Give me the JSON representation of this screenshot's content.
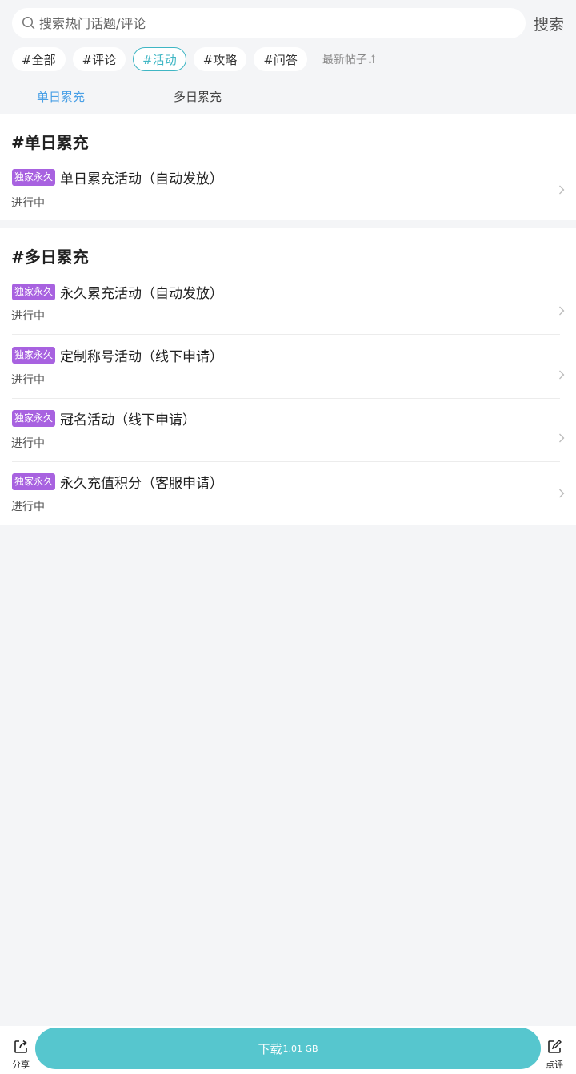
{
  "search": {
    "placeholder": "搜索热门话题/评论",
    "button_label": "搜索"
  },
  "chips": [
    "#全部",
    "#评论",
    "#活动",
    "#攻略",
    "#问答"
  ],
  "active_chip": "#活动",
  "sort_label": "最新帖子",
  "sort_icon": "sort-arrows-icon",
  "subtabs": [
    "单日累充",
    "多日累充"
  ],
  "active_subtab": "单日累充",
  "sections": [
    {
      "title": "#单日累充",
      "items": [
        {
          "badge": "独家永久",
          "title": "单日累充活动（自动发放）",
          "status": "进行中"
        }
      ]
    },
    {
      "title": "#多日累充",
      "items": [
        {
          "badge": "独家永久",
          "title": "永久累充活动（自动发放）",
          "status": "进行中"
        },
        {
          "badge": "独家永久",
          "title": "定制称号活动（线下申请）",
          "status": "进行中"
        },
        {
          "badge": "独家永久",
          "title": "冠名活动（线下申请）",
          "status": "进行中"
        },
        {
          "badge": "独家永久",
          "title": "永久充值积分（客服申请）",
          "status": "进行中"
        }
      ]
    }
  ],
  "bottom": {
    "share_label": "分享",
    "download_label": "下载",
    "download_size": "1.01 GB",
    "review_label": "点评"
  },
  "colors": {
    "accent": "#3fb6c4",
    "tab_active": "#4aa0e6",
    "badge": "#a862e0",
    "download": "#56c6ce"
  }
}
